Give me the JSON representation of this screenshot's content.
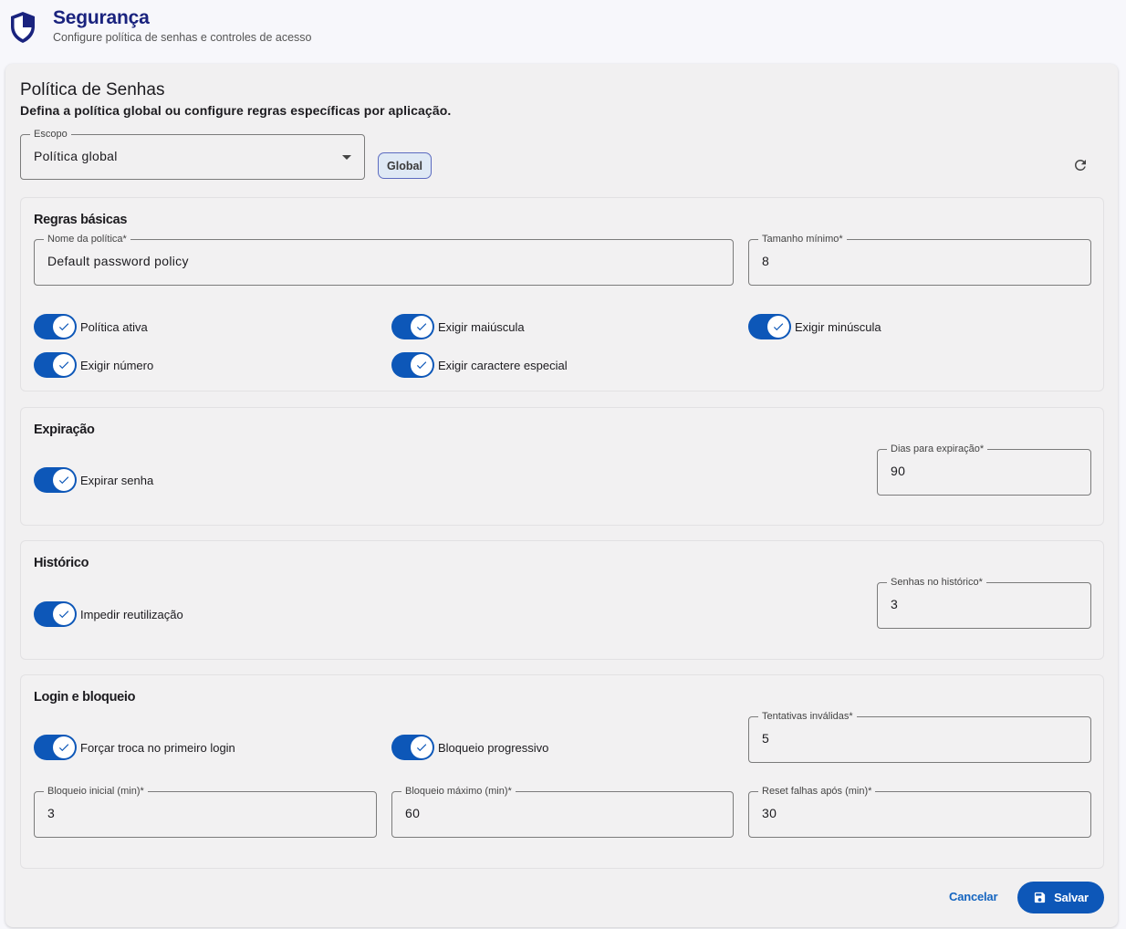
{
  "header": {
    "title": "Segurança",
    "subtitle": "Configure política de senhas e controles de acesso",
    "icon": "shield-icon"
  },
  "card": {
    "title": "Política de Senhas",
    "description": "Defina a política global ou configure regras específicas por aplicação."
  },
  "scope": {
    "label": "Escopo",
    "value": "Política global",
    "chip": "Global"
  },
  "basic_rules": {
    "title": "Regras básicas",
    "policy_name": {
      "label": "Nome da política*",
      "value": "Default password policy"
    },
    "min_length": {
      "label": "Tamanho mínimo*",
      "value": "8"
    },
    "toggles": [
      {
        "label": "Política ativa",
        "on": true
      },
      {
        "label": "Exigir maiúscula",
        "on": true
      },
      {
        "label": "Exigir minúscula",
        "on": true
      },
      {
        "label": "Exigir número",
        "on": true
      },
      {
        "label": "Exigir caractere especial",
        "on": true
      }
    ]
  },
  "expiration": {
    "title": "Expiração",
    "toggle": {
      "label": "Expirar senha",
      "on": true
    },
    "days": {
      "label": "Dias para expiração*",
      "value": "90"
    }
  },
  "history": {
    "title": "Histórico",
    "toggle": {
      "label": "Impedir reutilização",
      "on": true
    },
    "count": {
      "label": "Senhas no histórico*",
      "value": "3"
    }
  },
  "login": {
    "title": "Login e bloqueio",
    "force_change": {
      "label": "Forçar troca no primeiro login",
      "on": true
    },
    "progressive": {
      "label": "Bloqueio progressivo",
      "on": true
    },
    "invalid_attempts": {
      "label": "Tentativas inválidas*",
      "value": "5"
    },
    "initial_lock": {
      "label": "Bloqueio inicial (min)*",
      "value": "3"
    },
    "max_lock": {
      "label": "Bloqueio máximo (min)*",
      "value": "60"
    },
    "reset_after": {
      "label": "Reset falhas após (min)*",
      "value": "30"
    }
  },
  "actions": {
    "cancel": "Cancelar",
    "save": "Salvar"
  },
  "colors": {
    "primary": "#0d57b8",
    "title": "#1a237e"
  }
}
